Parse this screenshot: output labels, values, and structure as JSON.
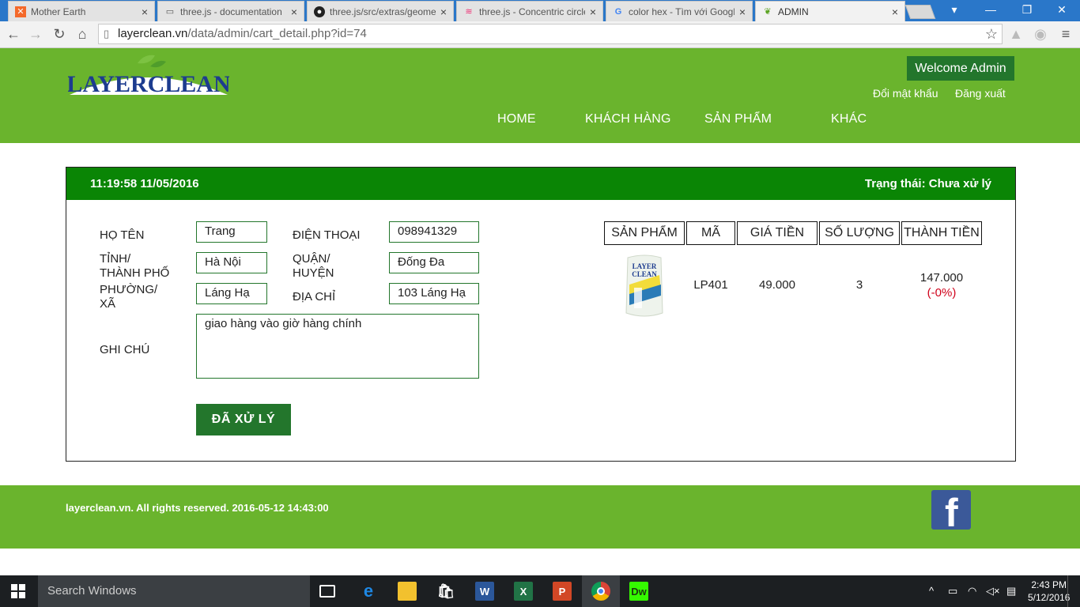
{
  "browser": {
    "tabs": [
      {
        "title": "Mother Earth",
        "icon": "xampp-icon"
      },
      {
        "title": "three.js - documentation",
        "icon": "page-icon"
      },
      {
        "title": "three.js/src/extras/geome",
        "icon": "github-icon"
      },
      {
        "title": "three.js - Concentric circle",
        "icon": "page-icon"
      },
      {
        "title": "color hex - Tìm với Googl",
        "icon": "google-icon"
      },
      {
        "title": "ADMIN",
        "icon": "leaf-icon"
      }
    ],
    "url_domain": "layerclean.vn",
    "url_path": "/data/admin/cart_detail.php?id=74"
  },
  "header": {
    "logo": "LAYERCLEAN",
    "welcome": "Welcome Admin",
    "change_password": "Đổi mật khẩu",
    "logout": "Đăng xuất",
    "nav": [
      "HOME",
      "KHÁCH HÀNG",
      "SẢN PHẨM",
      "KHÁC"
    ]
  },
  "order": {
    "datetime": "11:19:58 11/05/2016",
    "status": "Trạng thái: Chưa xử lý",
    "labels": {
      "name": "HỌ TÊN",
      "phone": "ĐIỆN THOẠI",
      "city_1": "TỈNH/",
      "city_2": "THÀNH PHỐ",
      "district_1": "QUẬN/",
      "district_2": "HUYỆN",
      "ward_1": "PHƯỜNG/",
      "ward_2": "XÃ",
      "address": "ĐỊA CHỈ",
      "note": "GHI CHÚ"
    },
    "values": {
      "name": "Trang",
      "phone": "098941329",
      "city": "Hà Nội",
      "district": "Đống Đa",
      "ward": "Láng Hạ",
      "address": "103 Láng Hạ",
      "note": "giao hàng vào giờ hàng chính"
    },
    "done_button": "ĐÃ XỬ LÝ",
    "table": {
      "headers": [
        "SẢN PHẨM",
        "MÃ",
        "GIÁ TIỀN",
        "SỐ LƯỢNG",
        "THÀNH TIỀN"
      ],
      "rows": [
        {
          "code": "LP401",
          "price": "49.000",
          "qty": "3",
          "total": "147.000",
          "discount": "(-0%)"
        }
      ]
    }
  },
  "footer": {
    "copyright": "layerclean.vn. All rights reserved. 2016-05-12 14:43:00"
  },
  "taskbar": {
    "search_placeholder": "Search Windows",
    "time": "2:43 PM",
    "date": "5/12/2016"
  },
  "colors": {
    "header_green": "#6ab42d",
    "dark_green": "#23762c",
    "panel_head_green": "#0a8505",
    "discount_red": "#d0021b"
  }
}
